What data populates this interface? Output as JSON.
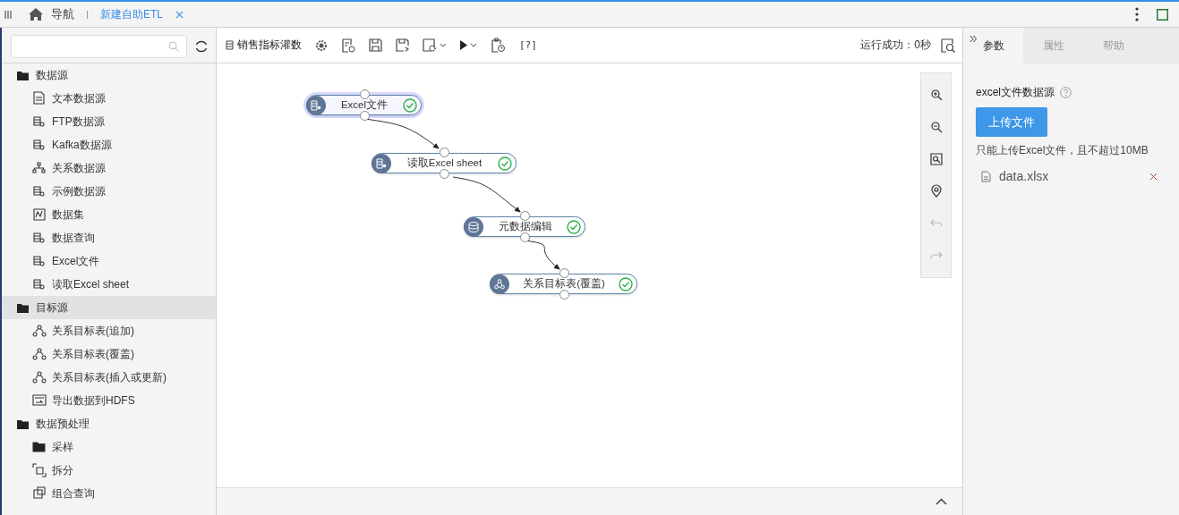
{
  "top_bar": {
    "nav_label": "导航",
    "tabs": [
      {
        "label": "新建自助ETL",
        "selected": true
      }
    ]
  },
  "tree": [
    {
      "label": "数据源",
      "kind": "folder",
      "selected": false,
      "children": [
        {
          "label": "文本数据源",
          "kind": "text-doc",
          "selected": false
        },
        {
          "label": "FTP数据源",
          "kind": "db",
          "selected": false
        },
        {
          "label": "Kafka数据源",
          "kind": "db",
          "selected": false
        },
        {
          "label": "关系数据源",
          "kind": "hierarchy",
          "selected": false
        },
        {
          "label": "示例数据源",
          "kind": "db",
          "selected": false
        },
        {
          "label": "数据集",
          "kind": "chart-doc",
          "selected": false
        },
        {
          "label": "数据查询",
          "kind": "db",
          "selected": false
        },
        {
          "label": "Excel文件",
          "kind": "db",
          "selected": false
        },
        {
          "label": "读取Excel sheet",
          "kind": "db",
          "selected": false
        }
      ]
    },
    {
      "label": "目标源",
      "kind": "folder",
      "selected": true,
      "children": [
        {
          "label": "关系目标表(追加)",
          "kind": "nodes",
          "selected": false
        },
        {
          "label": "关系目标表(覆盖)",
          "kind": "nodes",
          "selected": false
        },
        {
          "label": "关系目标表(插入或更新)",
          "kind": "nodes",
          "selected": false
        },
        {
          "label": "导出数据到HDFS",
          "kind": "export-doc",
          "selected": false
        }
      ]
    },
    {
      "label": "数据预处理",
      "kind": "folder",
      "selected": false,
      "children": [
        {
          "label": "采样",
          "kind": "closed-folder",
          "selected": false
        },
        {
          "label": "拆分",
          "kind": "split",
          "selected": false
        },
        {
          "label": "组合查询",
          "kind": "combine",
          "selected": false
        }
      ]
    }
  ],
  "toolbar": {
    "title": "销售指标灌数",
    "help": "[?]",
    "status": "运行成功：0秒"
  },
  "canvas": {
    "nodes": [
      {
        "label": "Excel文件",
        "kind": "db",
        "selected": true,
        "done": true
      },
      {
        "label": "读取Excel sheet",
        "kind": "db",
        "selected": false,
        "done": true
      },
      {
        "label": "元数据编辑",
        "kind": "stack",
        "selected": false,
        "done": true
      },
      {
        "label": "关系目标表(覆盖)",
        "kind": "nodes",
        "selected": false,
        "done": true
      }
    ],
    "tools": [
      {
        "kind": "zoom-in",
        "disabled": false
      },
      {
        "kind": "zoom-out",
        "disabled": false
      },
      {
        "kind": "fit",
        "disabled": false
      },
      {
        "kind": "locate",
        "disabled": false
      },
      {
        "kind": "undo",
        "disabled": true
      },
      {
        "kind": "redo",
        "disabled": true
      }
    ]
  },
  "panel": {
    "tabs": [
      {
        "label": "参数",
        "selected": true
      },
      {
        "label": "属性",
        "selected": false
      },
      {
        "label": "帮助",
        "selected": false
      }
    ],
    "field_label": "excel文件数据源",
    "upload_button": "上传文件",
    "hint": "只能上传Excel文件，且不超过10MB",
    "files": [
      "data.xlsx"
    ]
  }
}
